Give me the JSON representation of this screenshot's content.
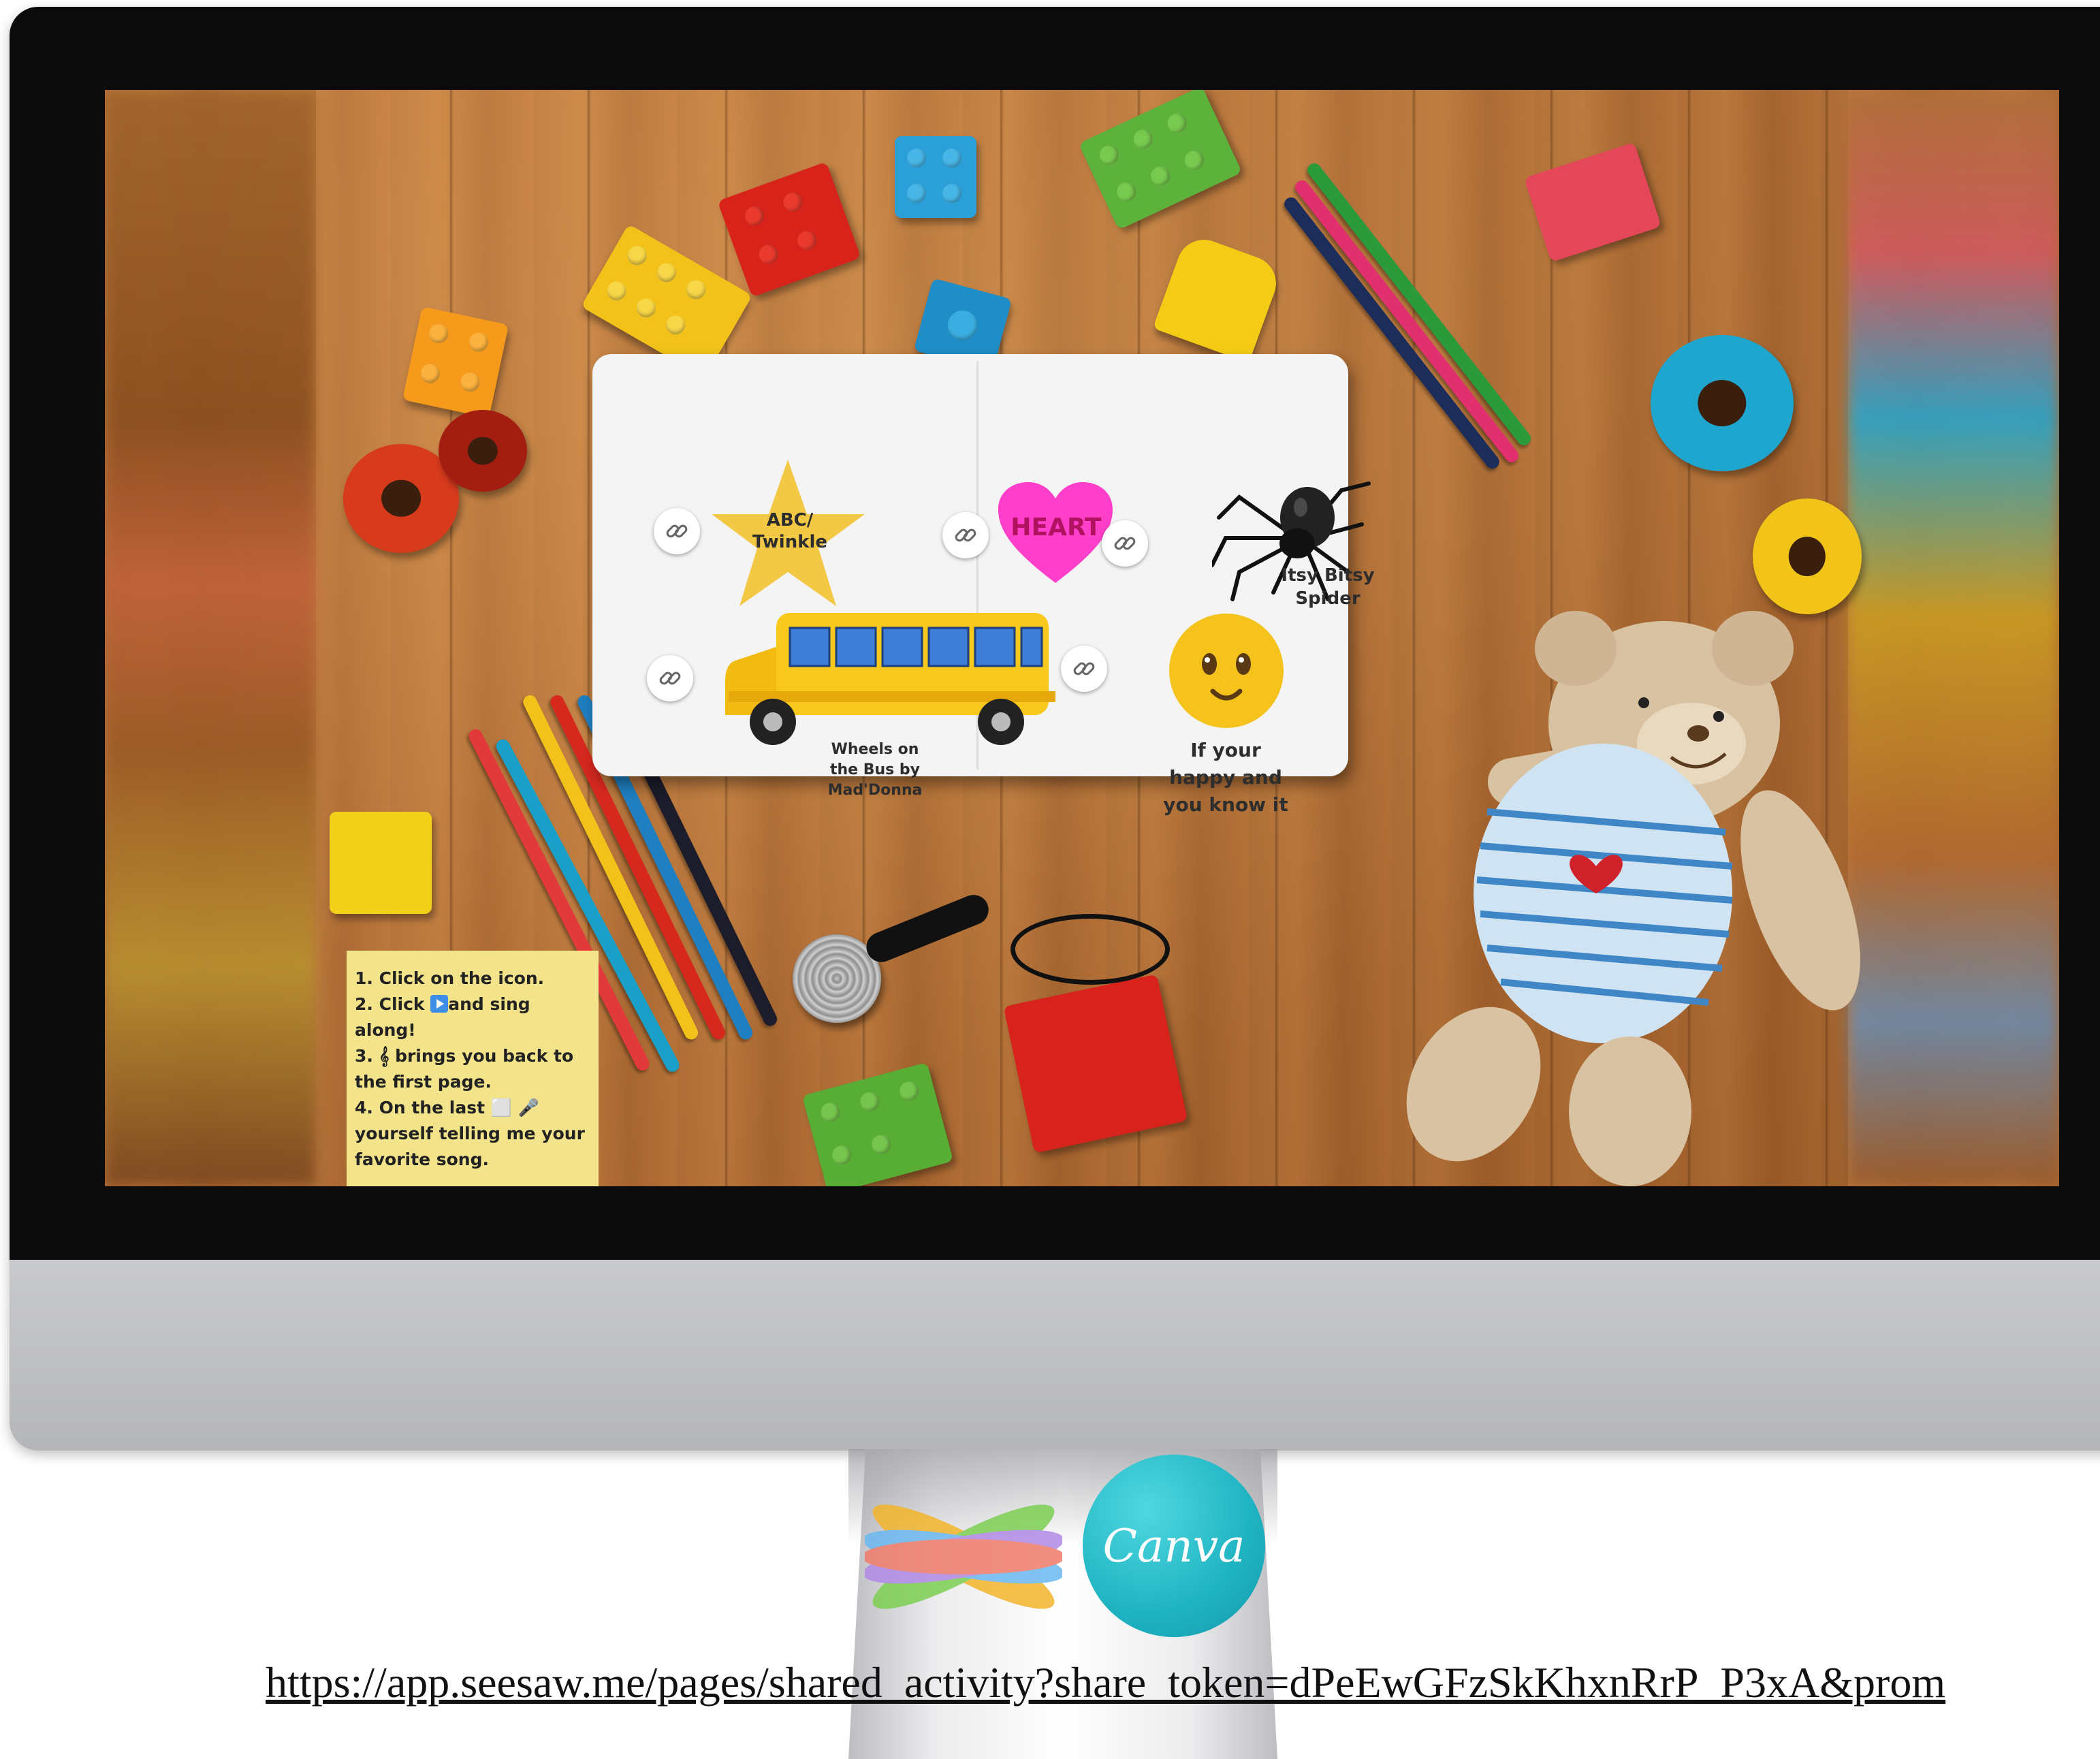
{
  "book": {
    "star_label_line1": "ABC/",
    "star_label_line2": "Twinkle",
    "heart_label": "HEART",
    "spider_label_line1": "Itsy Bitsy",
    "spider_label_line2": "Spider",
    "bus_label_line1": "Wheels on",
    "bus_label_line2": "the Bus by",
    "bus_label_line3": "Mad'Donna",
    "smiley_label_line1": "If your",
    "smiley_label_line2": "happy and",
    "smiley_label_line3": "you know it"
  },
  "instructions": {
    "line1": "1. Click on the icon.",
    "line2_prefix": "2. Click ",
    "line2_suffix": "and sing",
    "line3": "along!",
    "line4": "3. 𝄞 brings you back to",
    "line5": "the first page.",
    "line6": "4. On the last ⬜ 🎤",
    "line7": "yourself telling me your",
    "line8": "favorite song."
  },
  "logos": {
    "canva_text": "Canva",
    "seesaw_icon": "seesaw-logo-icon"
  },
  "link_url": "https://app.seesaw.me/pages/shared_activity?share_token=dPeEwGFzSkKhxnRrP_P3xA&prom",
  "colors": {
    "heart": "#ff3fc9",
    "star": "#f3c845",
    "note": "#f3e38a",
    "canva": "#1fb3c2"
  }
}
